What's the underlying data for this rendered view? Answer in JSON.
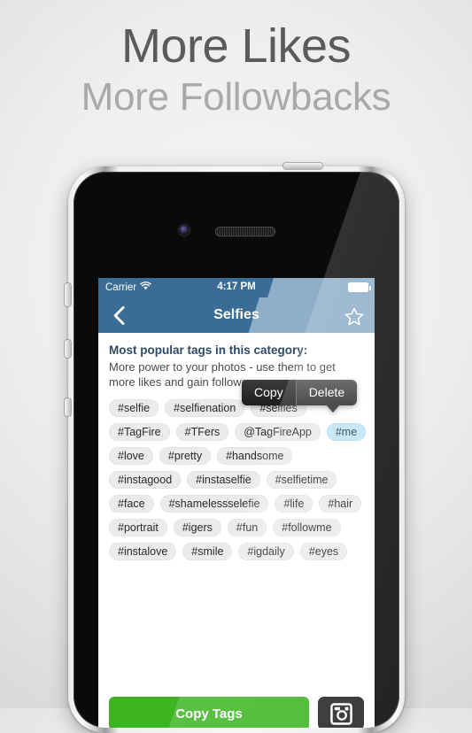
{
  "headline": {
    "line1": "More Likes",
    "line2": "More Followbacks"
  },
  "device": {
    "name": "iphone-4",
    "hardware": {
      "power_button": "power-button",
      "silent_switch": "silent-switch",
      "volume_up": "volume-up-button",
      "volume_down": "volume-down-button",
      "camera": "front-camera",
      "speaker": "earpiece-speaker"
    }
  },
  "statusbar": {
    "carrier": "Carrier",
    "wifi_icon": "wifi-icon",
    "time": "4:17 PM",
    "battery_icon": "battery-full-icon"
  },
  "navbar": {
    "back_icon": "chevron-left-icon",
    "title": "Selfies",
    "favorite_icon": "star-outline-icon"
  },
  "content": {
    "heading": "Most popular tags in this category:",
    "subtitle": "More power to your photos - use them to get more likes and gain followers."
  },
  "popup": {
    "copy_label": "Copy",
    "delete_label": "Delete"
  },
  "tags": {
    "rows": [
      [
        {
          "label": "#selfie",
          "selected": false
        },
        {
          "label": "#selfienation",
          "selected": false
        },
        {
          "label": "#selfies",
          "selected": false
        }
      ],
      [
        {
          "label": "#TagFire",
          "selected": false
        },
        {
          "label": "#TFers",
          "selected": false
        },
        {
          "label": "@TagFireApp",
          "selected": false
        },
        {
          "label": "#me",
          "selected": true
        }
      ],
      [
        {
          "label": "#love",
          "selected": false
        },
        {
          "label": "#pretty",
          "selected": false
        },
        {
          "label": "#handsome",
          "selected": false
        }
      ],
      [
        {
          "label": "#instagood",
          "selected": false
        },
        {
          "label": "#instaselfie",
          "selected": false
        },
        {
          "label": "#selfietime",
          "selected": false
        }
      ],
      [
        {
          "label": "#face",
          "selected": false
        },
        {
          "label": "#shamelessselefie",
          "selected": false
        },
        {
          "label": "#life",
          "selected": false
        },
        {
          "label": "#hair",
          "selected": false
        }
      ],
      [
        {
          "label": "#portrait",
          "selected": false
        },
        {
          "label": "#igers",
          "selected": false
        },
        {
          "label": "#fun",
          "selected": false
        },
        {
          "label": "#followme",
          "selected": false
        }
      ],
      [
        {
          "label": "#instalove",
          "selected": false
        },
        {
          "label": "#smile",
          "selected": false
        },
        {
          "label": "#igdaily",
          "selected": false
        },
        {
          "label": "#eyes",
          "selected": false
        }
      ]
    ]
  },
  "bottombar": {
    "copy_tags_label": "Copy Tags",
    "instagram_icon": "instagram-icon"
  },
  "colors": {
    "nav_dark_blue": "#3a6c96",
    "nav_light_blue": "#8fafc9",
    "heading_blue": "#2e4a63",
    "tag_grey": "#ebebeb",
    "tag_selected_blue": "#bfe4f7",
    "copy_tags_green": "#3cb521",
    "instagram_black": "#242424"
  }
}
